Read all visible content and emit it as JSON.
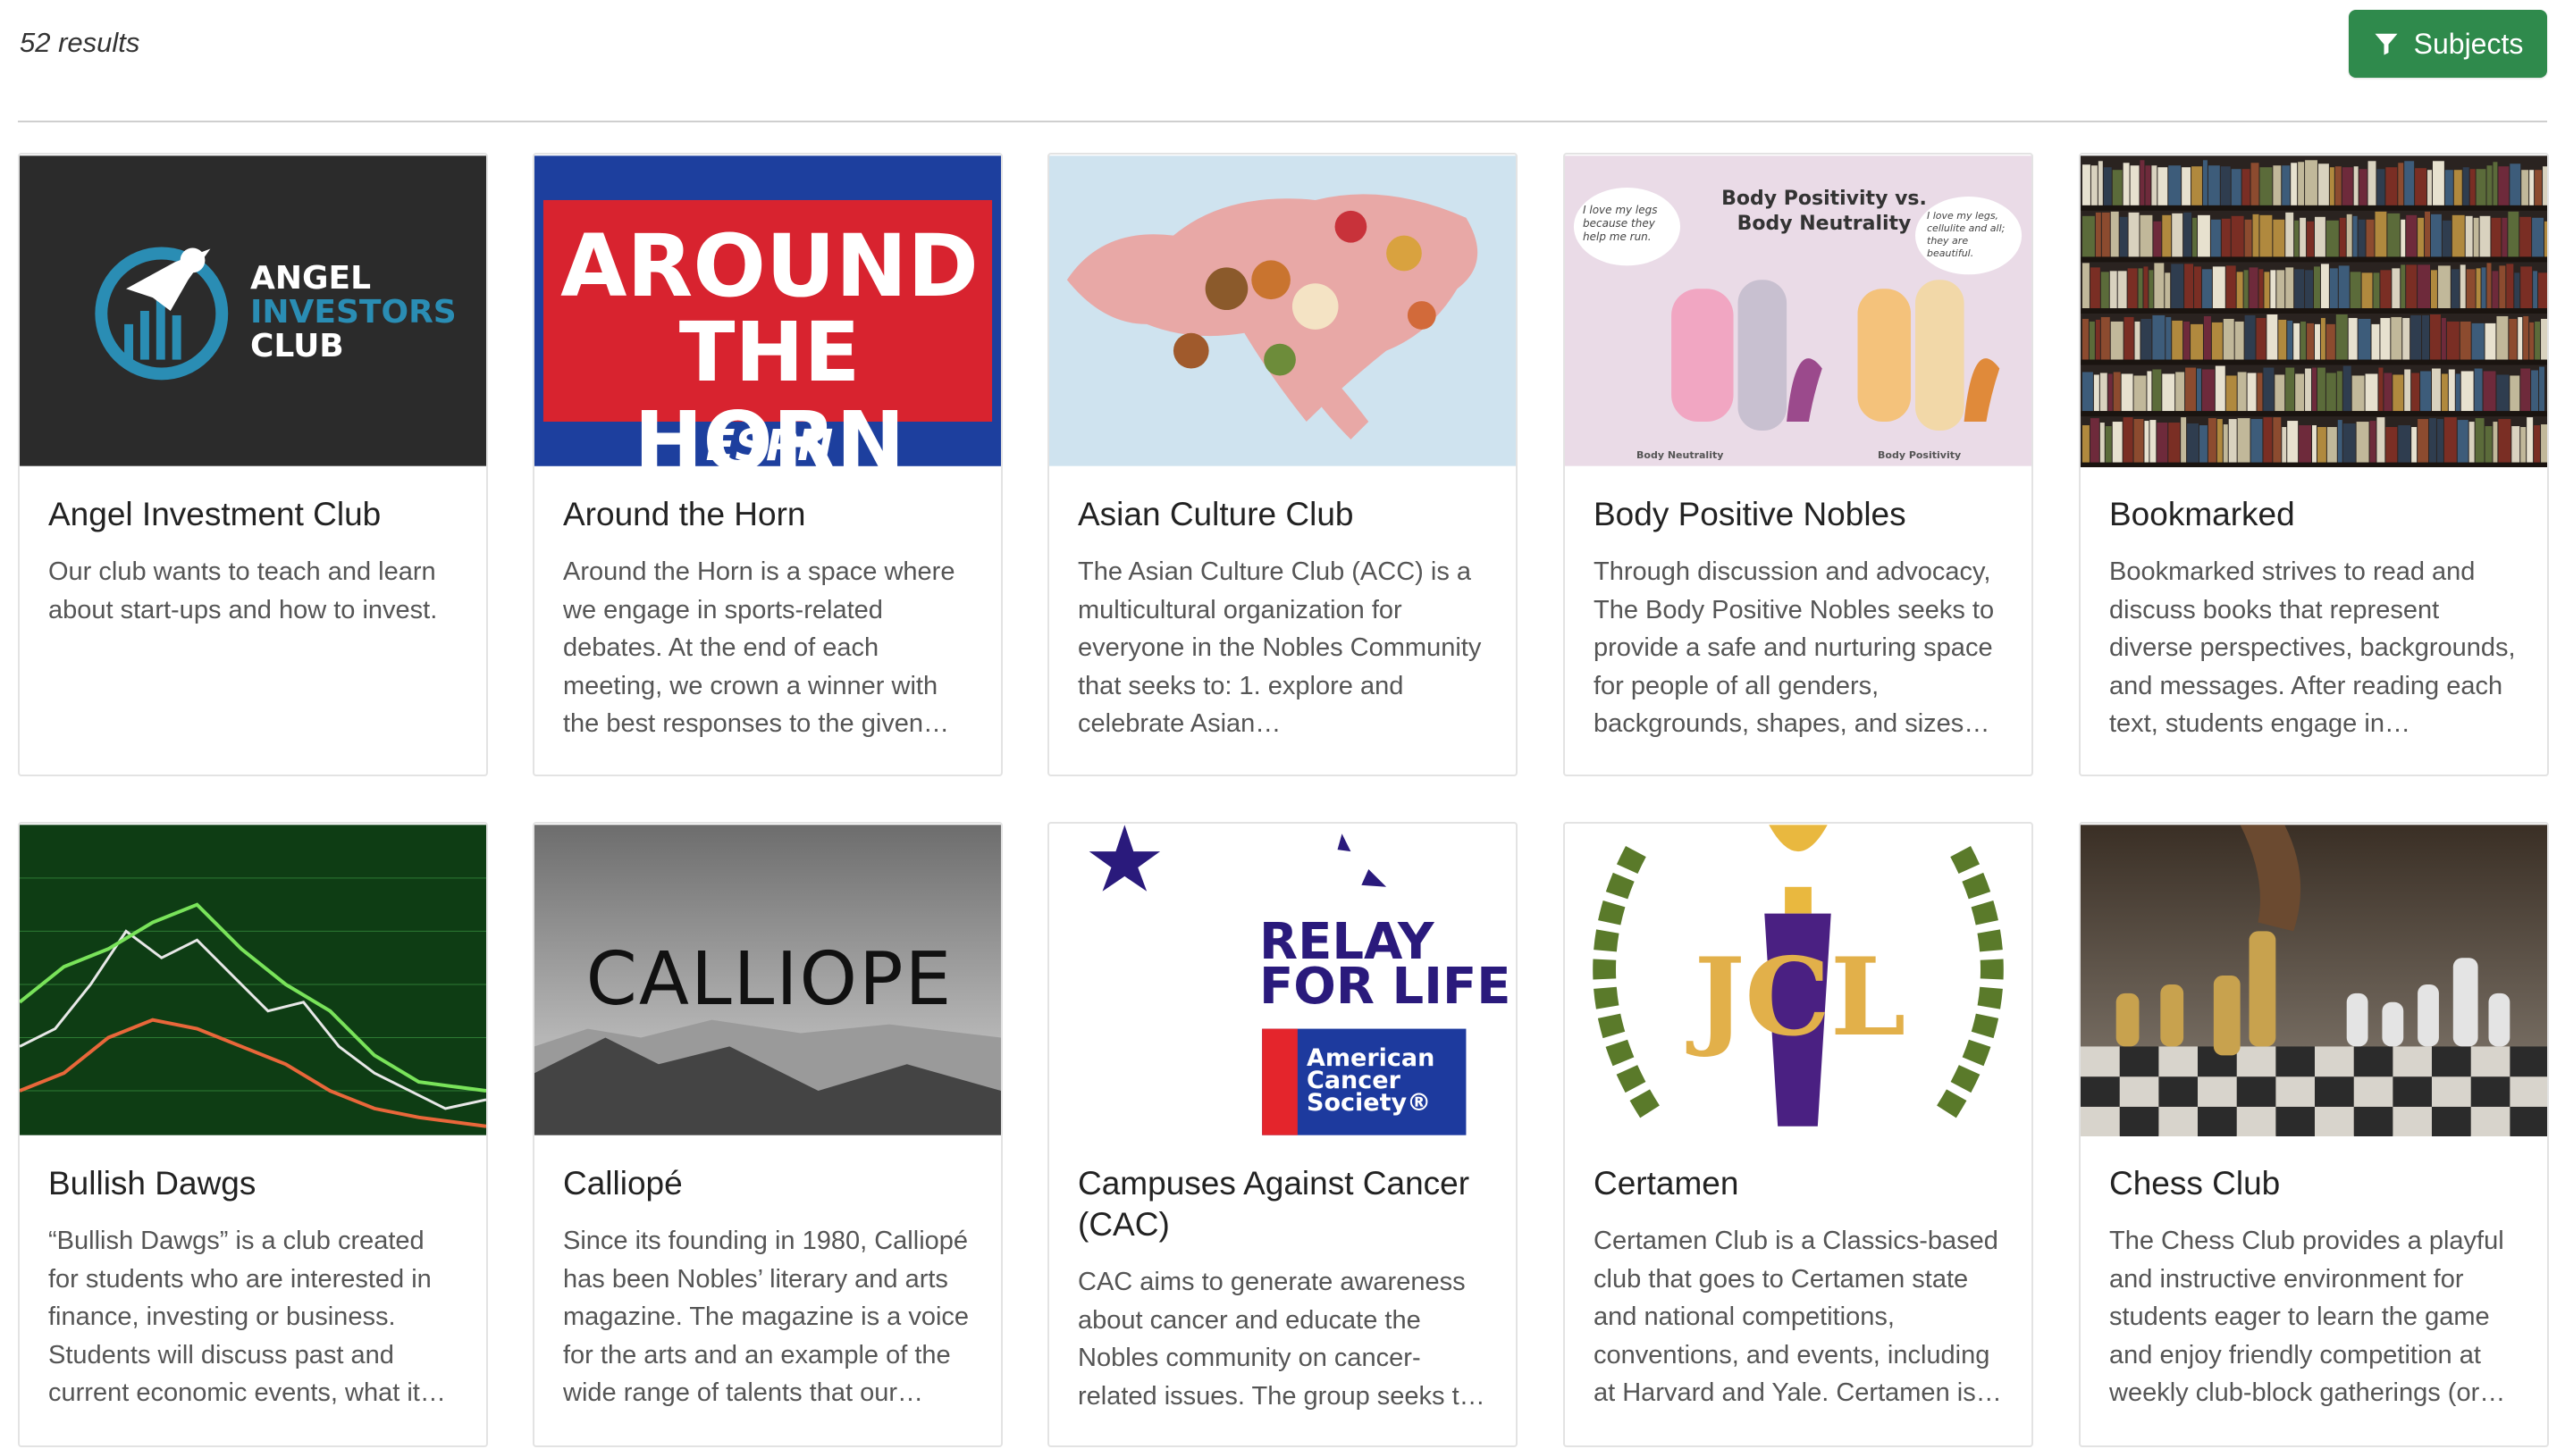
{
  "header": {
    "results_label": "52 results",
    "subjects_button": "Subjects"
  },
  "colors": {
    "accent_green": "#2f8a4c",
    "card_border": "#e3e3e3"
  },
  "cards": [
    {
      "title": "Angel Investment Club",
      "description": "Our club wants to teach and learn about start-ups and how to invest.",
      "image": {
        "logo_text": [
          "ANGEL",
          "INVESTORS",
          "CLUB"
        ]
      }
    },
    {
      "title": "Around the Horn",
      "description": "Around the Horn is a space where we engage in sports-related debates. At the end of each meeting, we crown a winner with the best responses to the given…",
      "image": {
        "line1": "AROUND",
        "line2": "THE HORN",
        "footer": "ESPN"
      }
    },
    {
      "title": "Asian Culture Club",
      "description": "The Asian Culture Club (ACC) is a multicultural organization for everyone in the Nobles Community that seeks to: 1. explore and celebrate Asian…"
    },
    {
      "title": "Body Positive Nobles",
      "description": "Through discussion and advocacy, The Body Positive Nobles seeks to provide a safe and nurturing space for people of all genders, backgrounds, shapes, and sizes t…",
      "image": {
        "heading": "Body Positivity vs. Body Neutrality",
        "bubble_left": "I love my legs because they help me run.",
        "bubble_right": "I love my legs, cellulite and all; they are beautiful.",
        "label_left": "Body Neutrality",
        "label_right": "Body Positivity"
      }
    },
    {
      "title": "Bookmarked",
      "description": "Bookmarked strives to read and discuss books that represent diverse perspectives, backgrounds, and messages. After reading each text, students engage in…"
    },
    {
      "title": "Bullish Dawgs",
      "description": "“Bullish Dawgs” is a club created for students who are interested in finance, investing or business. Students will discuss past and current economic events, what it…"
    },
    {
      "title": "Calliopé",
      "description": "Since its founding in 1980, Calliopé has been Nobles’ literary and arts magazine. The magazine is a voice for the arts and an example of the wide range of talents that our…",
      "image": {
        "word": "CALLIOPE"
      }
    },
    {
      "title": "Campuses Against Cancer (CAC)",
      "description": "CAC aims to generate awareness about cancer and educate the Nobles community on cancer-related issues. The group seeks t…",
      "image": {
        "line1": "RELAY",
        "line2": "FOR LIFE",
        "society": [
          "American",
          "Cancer",
          "Society®"
        ]
      }
    },
    {
      "title": "Certamen",
      "description": "Certamen Club is a Classics-based club that goes to Certamen state and national competitions, conventions, and events, including at Harvard and Yale. Certamen is…",
      "image": {
        "letters": "JCL"
      }
    },
    {
      "title": "Chess Club",
      "description": "The Chess Club provides a playful and instructive environment for students eager to learn the game and enjoy friendly competition at weekly club-block gatherings (or…"
    }
  ]
}
